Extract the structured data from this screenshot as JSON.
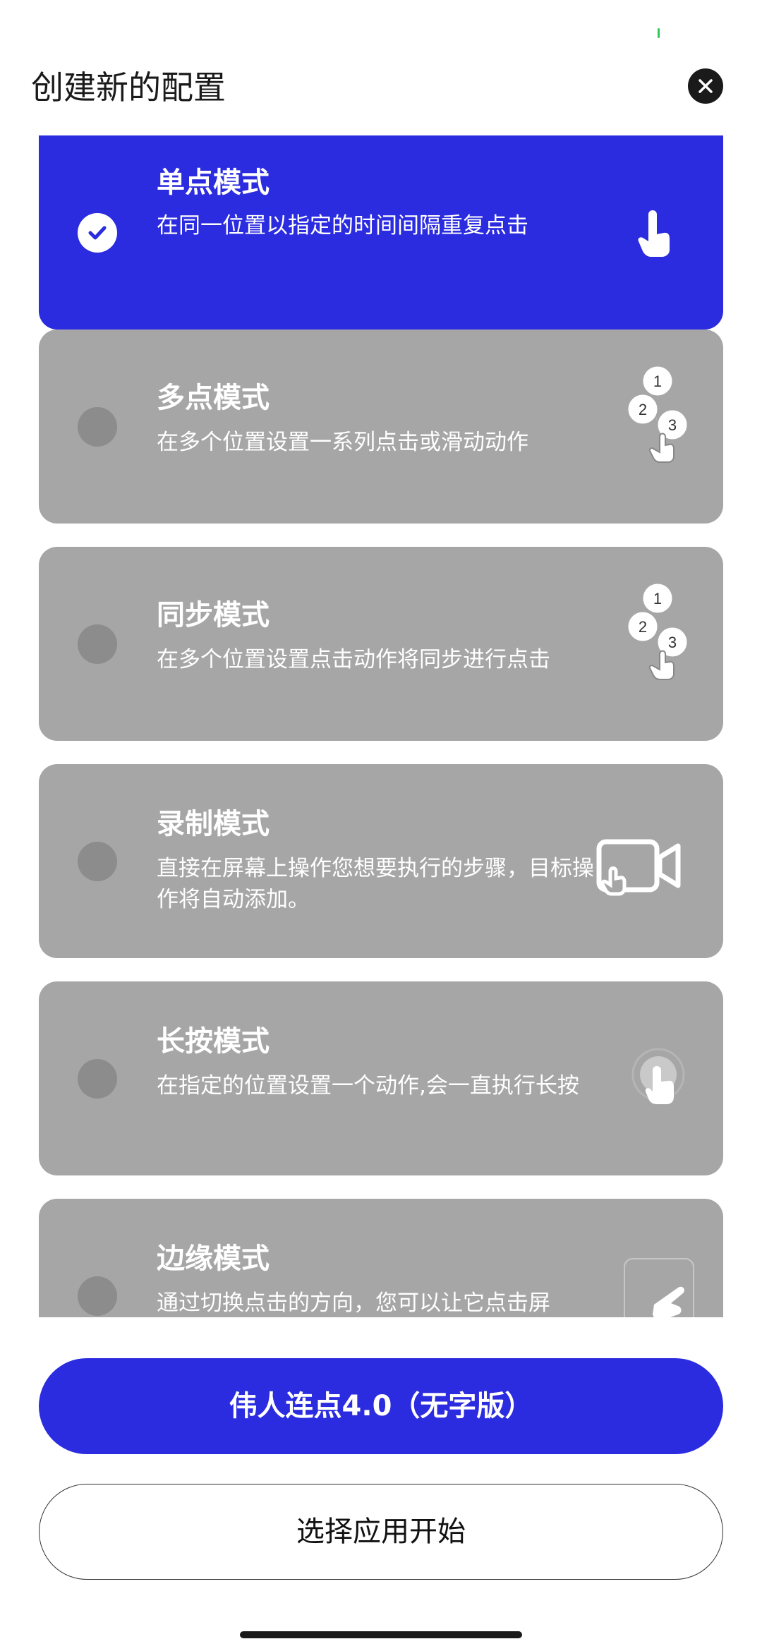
{
  "header": {
    "title": "创建新的配置"
  },
  "modes": [
    {
      "title": "单点模式",
      "desc": "在同一位置以指定的时间间隔重复点击",
      "selected": true,
      "icon": "single-tap-icon"
    },
    {
      "title": "多点模式",
      "desc": "在多个位置设置一系列点击或滑动动作",
      "selected": false,
      "icon": "multi-tap-icon"
    },
    {
      "title": "同步模式",
      "desc": "在多个位置设置点击动作将同步进行点击",
      "selected": false,
      "icon": "sync-tap-icon"
    },
    {
      "title": "录制模式",
      "desc": "直接在屏幕上操作您想要执行的步骤，目标操作将自动添加。",
      "selected": false,
      "icon": "record-icon"
    },
    {
      "title": "长按模式",
      "desc": "在指定的位置设置一个动作,会一直执行长按",
      "selected": false,
      "icon": "long-press-icon"
    },
    {
      "title": "边缘模式",
      "desc": "通过切换点击的方向，您可以让它点击屏",
      "selected": false,
      "icon": "edge-tap-icon"
    }
  ],
  "step_labels": [
    "1",
    "2",
    "3"
  ],
  "buttons": {
    "primary": "伟人连点4.0（无字版）",
    "secondary": "选择应用开始"
  },
  "colors": {
    "accent": "#2b2be0",
    "card": "#a6a6a6"
  }
}
